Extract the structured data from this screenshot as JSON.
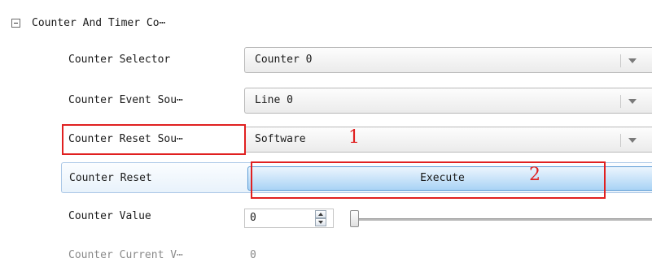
{
  "group": {
    "title": "Counter And Timer Co⋯",
    "collapse_symbol": "minus"
  },
  "rows": [
    {
      "label": "Counter Selector",
      "value": "Counter 0"
    },
    {
      "label": "Counter Event Sou⋯",
      "value": "Line 0"
    },
    {
      "label": "Counter Reset Sou⋯",
      "value": "Software"
    },
    {
      "label": "Counter Reset",
      "button": "Execute"
    },
    {
      "label": "Counter Value",
      "value": "0"
    },
    {
      "label": "Counter Current V⋯",
      "value": "0"
    }
  ],
  "annotations": [
    {
      "text": "1",
      "color": "#e02020"
    },
    {
      "text": "2",
      "color": "#e02020"
    }
  ],
  "icons": {
    "dropdown": "chevron-down-icon",
    "spin_up": "spin-up-icon",
    "spin_down": "spin-down-icon"
  },
  "colors": {
    "highlight": "#e02020",
    "button_blue": "#a9d3f5",
    "disabled_text": "#8a8a8a"
  }
}
